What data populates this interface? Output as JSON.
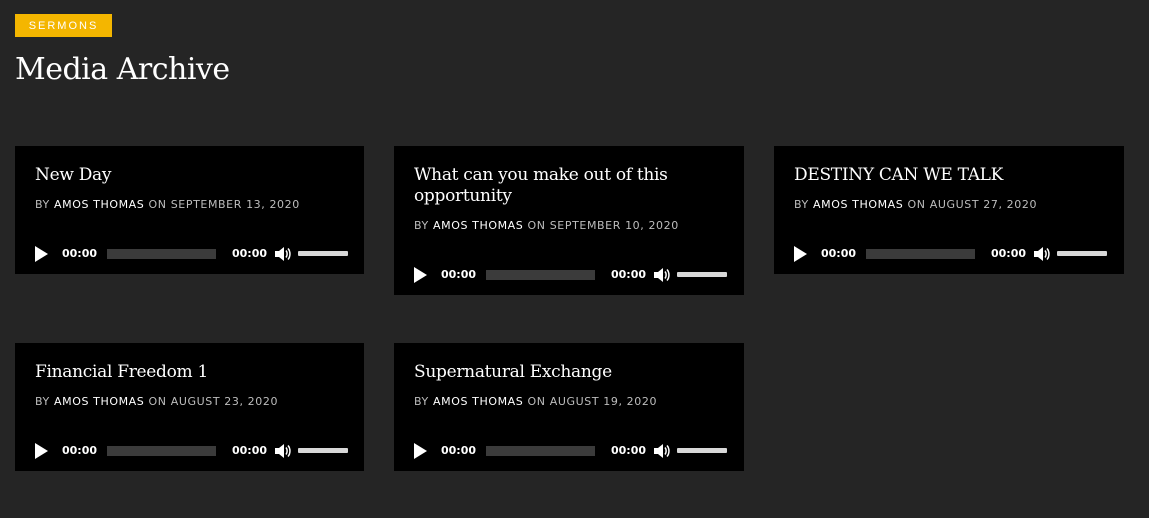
{
  "category_tag": "SERMONS",
  "page_title": "Media Archive",
  "by_label": "BY",
  "on_label": "ON",
  "sermons": [
    {
      "title": "New Day",
      "author": "AMOS THOMAS",
      "date": "SEPTEMBER 13, 2020",
      "current_time": "00:00",
      "duration": "00:00"
    },
    {
      "title": "What can you make out of this opportunity",
      "author": "AMOS THOMAS",
      "date": "SEPTEMBER 10, 2020",
      "current_time": "00:00",
      "duration": "00:00"
    },
    {
      "title": "DESTINY CAN WE TALK",
      "author": "AMOS THOMAS",
      "date": "AUGUST 27, 2020",
      "current_time": "00:00",
      "duration": "00:00"
    },
    {
      "title": "Financial Freedom 1",
      "author": "AMOS THOMAS",
      "date": "AUGUST 23, 2020",
      "current_time": "00:00",
      "duration": "00:00"
    },
    {
      "title": "Supernatural Exchange",
      "author": "AMOS THOMAS",
      "date": "AUGUST 19, 2020",
      "current_time": "00:00",
      "duration": "00:00"
    }
  ],
  "colors": {
    "accent": "#f4b600",
    "background": "#252525",
    "card": "#000000"
  },
  "icons": {
    "play": "play-icon",
    "volume": "volume-icon"
  }
}
